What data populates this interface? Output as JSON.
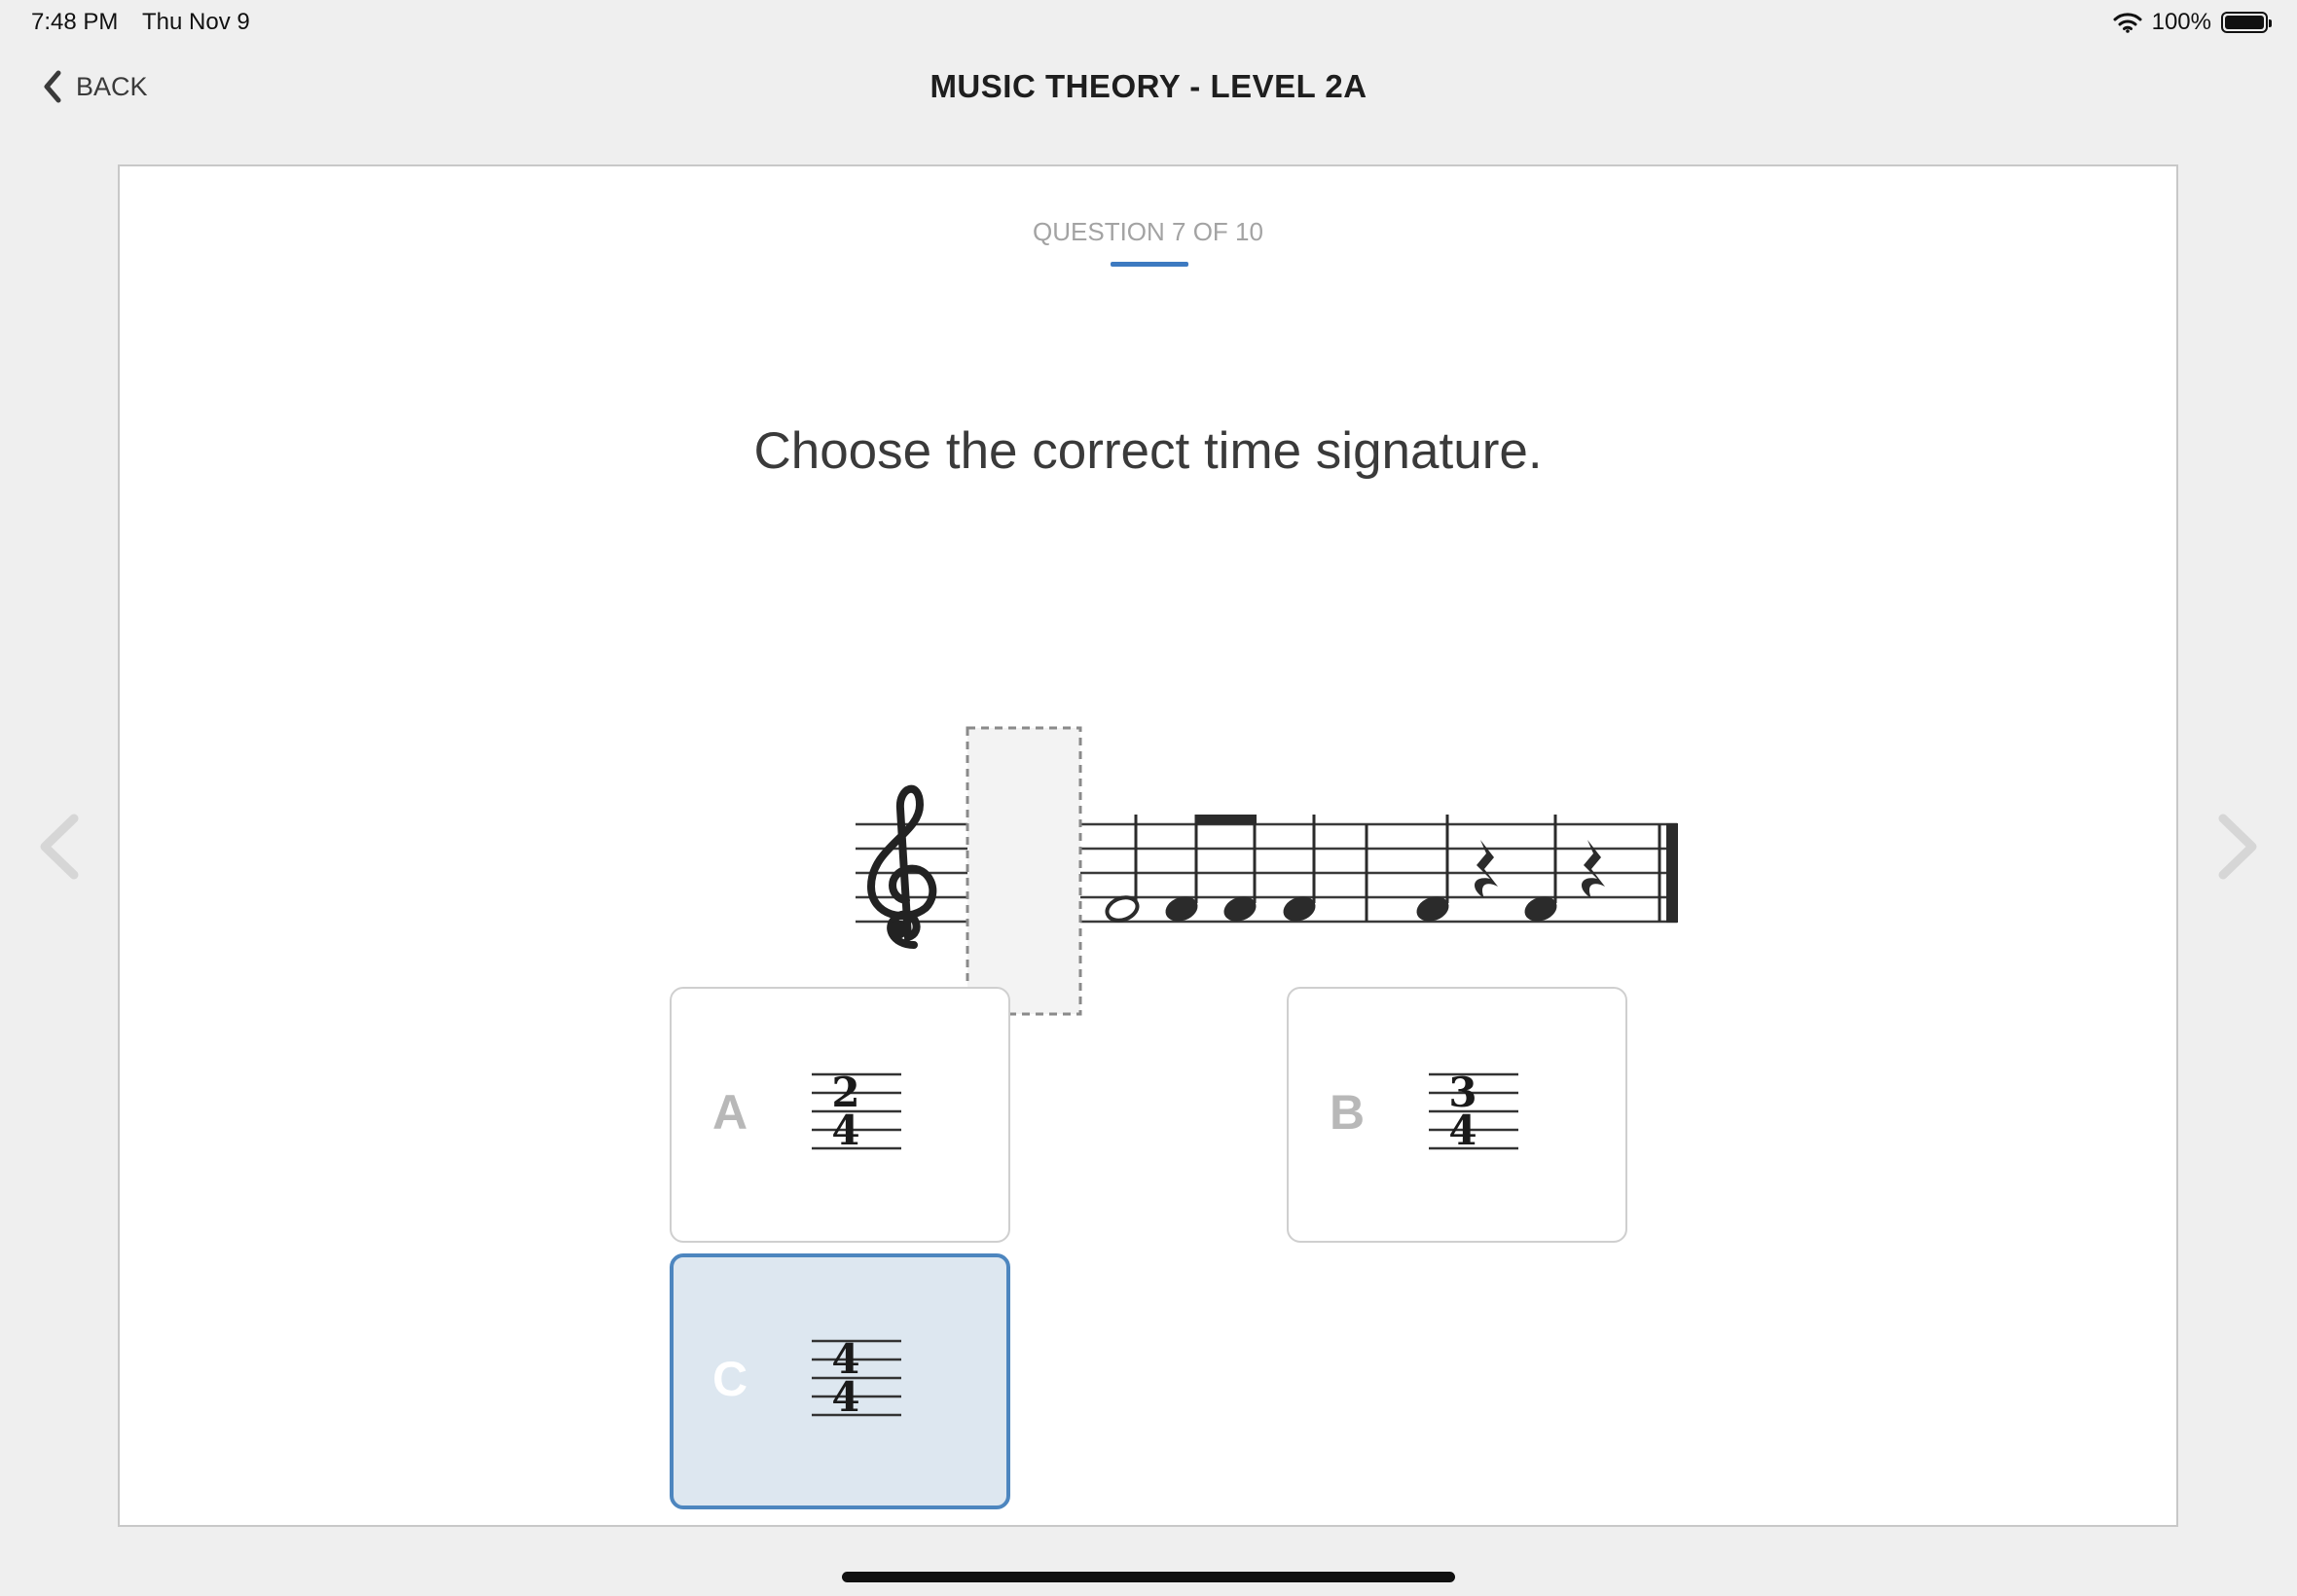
{
  "status_bar": {
    "time": "7:48 PM",
    "date": "Thu Nov 9",
    "wifi_icon": "wifi-icon",
    "battery_percent": "100%",
    "battery_level": 1.0
  },
  "header": {
    "back_label": "BACK",
    "back_icon": "chevron-left-icon",
    "title": "MUSIC THEORY - LEVEL 2A"
  },
  "quiz": {
    "counter": "QUESTION 7 OF 10",
    "prompt": "Choose the correct time signature.",
    "answers": [
      {
        "letter": "A",
        "top": "2",
        "bottom": "4",
        "selected": false
      },
      {
        "letter": "B",
        "top": "3",
        "bottom": "4",
        "selected": false
      },
      {
        "letter": "C",
        "top": "4",
        "bottom": "4",
        "selected": true
      }
    ]
  },
  "colors": {
    "accent": "#3d7ac1",
    "selected_bg": "#dde7f0",
    "selected_border": "#4d86bf",
    "background": "#efefef"
  }
}
